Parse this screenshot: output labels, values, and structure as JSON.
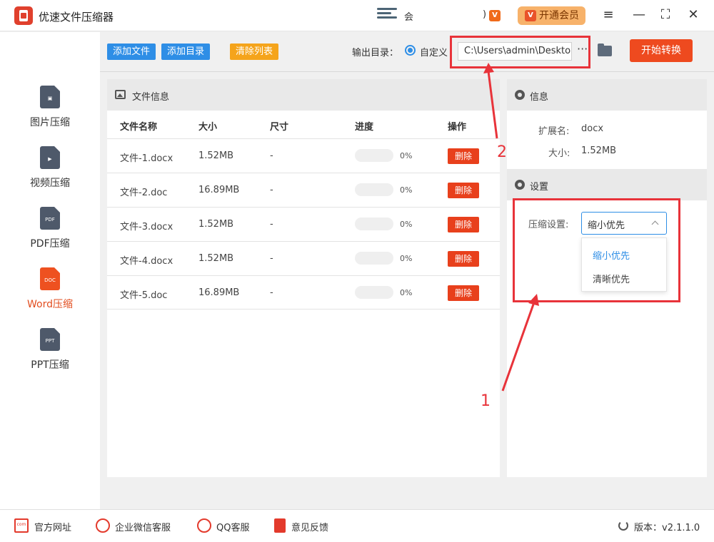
{
  "window": {
    "title": "优速文件压缩器",
    "user_name": "会",
    "user_paren": ")",
    "vip_button": "开通会员",
    "vip_icon_letter": "V",
    "controls": {
      "menu": "≡",
      "minimize": "—",
      "maximize": "⛶",
      "close": "✕"
    }
  },
  "sidebar": {
    "items": [
      {
        "label": "图片压缩",
        "icon": "image-file-icon",
        "glyph": "▣",
        "active": false
      },
      {
        "label": "视频压缩",
        "icon": "video-file-icon",
        "glyph": "▶",
        "active": false
      },
      {
        "label": "PDF压缩",
        "icon": "pdf-file-icon",
        "glyph": "PDF",
        "active": false
      },
      {
        "label": "Word压缩",
        "icon": "doc-file-icon",
        "glyph": "DOC",
        "active": true
      },
      {
        "label": "PPT压缩",
        "icon": "ppt-file-icon",
        "glyph": "PPT",
        "active": false
      }
    ]
  },
  "toolbar": {
    "add_file": "添加文件",
    "add_folder": "添加目录",
    "clear_list": "清除列表",
    "output_label": "输出目录：",
    "radio_label": "自定义",
    "output_path": "C:\\Users\\admin\\Desktop",
    "more": "···",
    "start": "开始转换"
  },
  "file_panel": {
    "title": "文件信息",
    "columns": [
      "文件名称",
      "大小",
      "尺寸",
      "进度",
      "操作"
    ],
    "rows": [
      {
        "name": "文件-1.docx",
        "size": "1.52MB",
        "dim": "-",
        "progress": 0,
        "progress_text": "0%",
        "action": "删除"
      },
      {
        "name": "文件-2.doc",
        "size": "16.89MB",
        "dim": "-",
        "progress": 0,
        "progress_text": "0%",
        "action": "删除"
      },
      {
        "name": "文件-3.docx",
        "size": "1.52MB",
        "dim": "-",
        "progress": 0,
        "progress_text": "0%",
        "action": "删除"
      },
      {
        "name": "文件-4.docx",
        "size": "1.52MB",
        "dim": "-",
        "progress": 0,
        "progress_text": "0%",
        "action": "删除"
      },
      {
        "name": "文件-5.doc",
        "size": "16.89MB",
        "dim": "-",
        "progress": 0,
        "progress_text": "0%",
        "action": "删除"
      }
    ]
  },
  "info_panel": {
    "title": "信息",
    "ext_label": "扩展名:",
    "ext_value": "docx",
    "size_label": "大小:",
    "size_value": "1.52MB"
  },
  "settings_panel": {
    "title": "设置",
    "compress_label": "压缩设置:",
    "selected": "缩小优先",
    "options": [
      "缩小优先",
      "清晰优先"
    ]
  },
  "annotations": {
    "one": "1",
    "two": "2",
    "color": "#e8333a"
  },
  "footer": {
    "website": "官方网址",
    "wechat": "企业微信客服",
    "qq": "QQ客服",
    "feedback": "意见反馈",
    "version": "版本：v2.1.1.0"
  },
  "colors": {
    "accent_blue": "#2e8ee6",
    "start_red": "#ee4a1f",
    "delete_red": "#e8401c",
    "clear_orange": "#f5a41b",
    "active_orange": "#ee5120"
  }
}
